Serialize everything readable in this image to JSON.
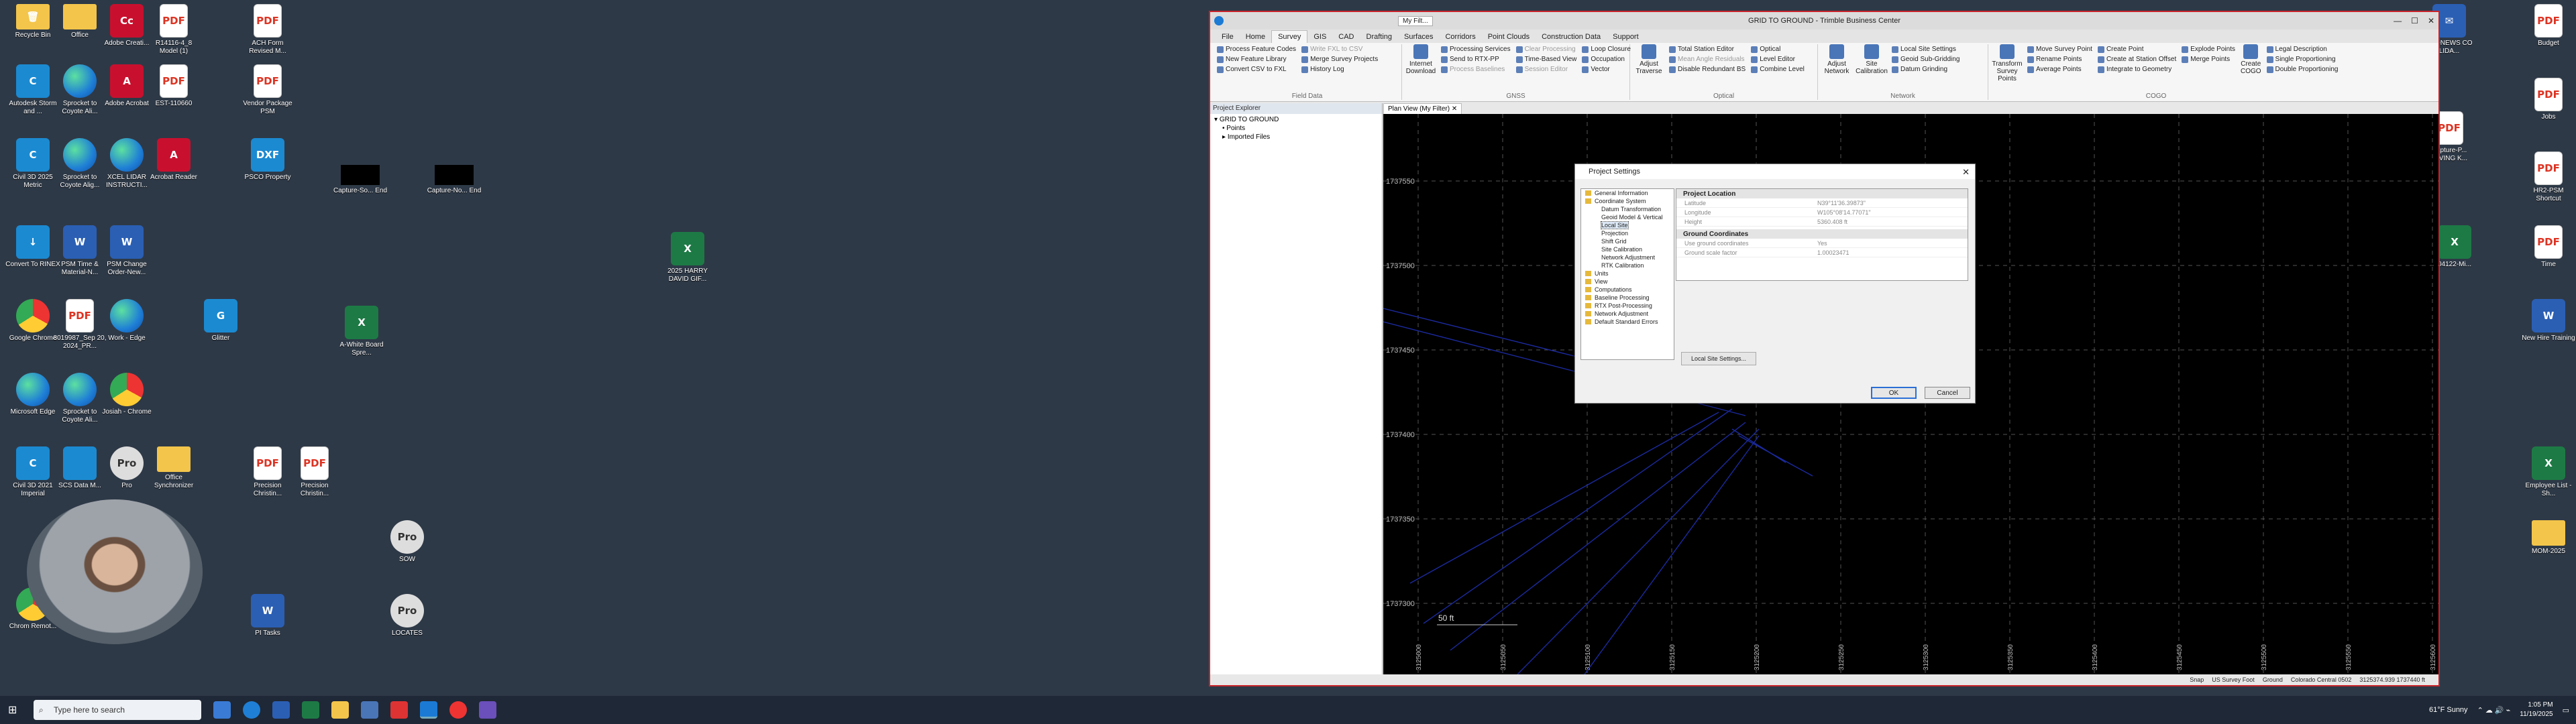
{
  "desktop": {
    "icons": [
      {
        "label": "Recycle Bin",
        "kind": "folder",
        "glyph": "🗑"
      },
      {
        "label": "Office",
        "kind": "folder",
        "glyph": ""
      },
      {
        "label": "Adobe Creati...",
        "kind": "adobe",
        "glyph": "Cc"
      },
      {
        "label": "R14116-4_8 Model (1)",
        "kind": "pdf",
        "glyph": "PDF"
      },
      {
        "label": "ACH Form Revised M...",
        "kind": "pdf",
        "glyph": "PDF"
      },
      {
        "label": "Autodesk Storm and ...",
        "kind": "c3d",
        "glyph": "C"
      },
      {
        "label": "Sprocket to Coyote Ali...",
        "kind": "edge",
        "glyph": ""
      },
      {
        "label": "Adobe Acrobat",
        "kind": "adobe",
        "glyph": "A"
      },
      {
        "label": "EST-110660",
        "kind": "pdf",
        "glyph": "PDF"
      },
      {
        "label": "Vendor Package PSM",
        "kind": "pdf",
        "glyph": "PDF"
      },
      {
        "label": "Civil 3D 2025 Metric",
        "kind": "c3d",
        "glyph": "C"
      },
      {
        "label": "Sprocket to Coyote Alig...",
        "kind": "edge",
        "glyph": ""
      },
      {
        "label": "XCEL LIDAR INSTRUCTI...",
        "kind": "edge",
        "glyph": ""
      },
      {
        "label": "Acrobat Reader",
        "kind": "adobe",
        "glyph": "A"
      },
      {
        "label": "PSCO Property",
        "kind": "c3d",
        "glyph": "DXF"
      },
      {
        "label": "Capture-So... End",
        "kind": "black",
        "glyph": ""
      },
      {
        "label": "Capture-No... End",
        "kind": "black",
        "glyph": ""
      },
      {
        "label": "Convert To RINEX",
        "kind": "c3d",
        "glyph": "↓"
      },
      {
        "label": "PSM Time & Material-N...",
        "kind": "word",
        "glyph": "W"
      },
      {
        "label": "PSM Change Order-New...",
        "kind": "word",
        "glyph": "W"
      },
      {
        "label": "2025 HARRY DAVID GIF...",
        "kind": "excel",
        "glyph": "X"
      },
      {
        "label": "Google Chrome",
        "kind": "chrome",
        "glyph": ""
      },
      {
        "label": "8019987_Sep 20, 2024_PR...",
        "kind": "pdf",
        "glyph": "PDF"
      },
      {
        "label": "Work - Edge",
        "kind": "edge",
        "glyph": ""
      },
      {
        "label": "Glitter",
        "kind": "c3d",
        "glyph": "G"
      },
      {
        "label": "A-White Board Spre...",
        "kind": "excel",
        "glyph": "X"
      },
      {
        "label": "Microsoft Edge",
        "kind": "edge",
        "glyph": ""
      },
      {
        "label": "Sprocket to Coyote Ali...",
        "kind": "edge",
        "glyph": ""
      },
      {
        "label": "Josiah - Chrome",
        "kind": "chrome",
        "glyph": ""
      },
      {
        "label": "Civil 3D 2021 Imperial",
        "kind": "c3d",
        "glyph": "C"
      },
      {
        "label": "SCS Data M...",
        "kind": "c3d",
        "glyph": ""
      },
      {
        "label": "Pro",
        "kind": "pro",
        "glyph": "Pro"
      },
      {
        "label": "Office Synchronizer",
        "kind": "folder",
        "glyph": ""
      },
      {
        "label": "Precision Christin...",
        "kind": "pdf",
        "glyph": "PDF"
      },
      {
        "label": "Precision Christin...",
        "kind": "pdf",
        "glyph": "PDF"
      },
      {
        "label": "SOW",
        "kind": "pro",
        "glyph": "Pro"
      },
      {
        "label": "PI Tasks",
        "kind": "word",
        "glyph": "W"
      },
      {
        "label": "LOCATES",
        "kind": "pro",
        "glyph": "Pro"
      },
      {
        "label": "Chrom Remot...",
        "kind": "chrome",
        "glyph": ""
      },
      {
        "label": "Budget",
        "kind": "pdf",
        "glyph": "PDF"
      },
      {
        "label": "Jobs",
        "kind": "pdf",
        "glyph": "PDF"
      },
      {
        "label": "HR2-PSM Shortcut",
        "kind": "pdf",
        "glyph": "PDF"
      },
      {
        "label": "Time",
        "kind": "pdf",
        "glyph": "PDF"
      },
      {
        "label": "New Hire Training",
        "kind": "word",
        "glyph": "W"
      },
      {
        "label": "Employee List - Sh...",
        "kind": "excel",
        "glyph": "X"
      },
      {
        "label": "MOM-2025",
        "kind": "folder",
        "glyph": ""
      },
      {
        "label": "RT eNEWS CO LIDA...",
        "kind": "word",
        "glyph": "✉"
      },
      {
        "label": "Capture-P... PAVING K...",
        "kind": "pdf",
        "glyph": "PDF"
      },
      {
        "label": "04122-Mi...",
        "kind": "excel",
        "glyph": "X"
      }
    ]
  },
  "app": {
    "title": "GRID TO GROUND - Trimble Business Center",
    "qat_text": "My Filt...",
    "menu_tabs": [
      "File",
      "Home",
      "Survey",
      "GIS",
      "CAD",
      "Drafting",
      "Surfaces",
      "Corridors",
      "Point Clouds",
      "Construction Data",
      "Support"
    ],
    "active_tab": "Survey",
    "ribbon": {
      "field_data": {
        "label": "Field Data",
        "items": [
          "Process Feature Codes",
          "New Feature Library",
          "Convert CSV to FXL",
          "Write FXL to CSV",
          "Merge Survey Projects",
          "History Log"
        ]
      },
      "gnss": {
        "label": "GNSS",
        "big": "Internet Download",
        "items": [
          "Processing Services",
          "Send to RTX-PP",
          "Process Baselines",
          "Clear Processing",
          "Time-Based View",
          "Session Editor",
          "Loop Closure",
          "Occupation",
          "Vector"
        ]
      },
      "optical": {
        "label": "Optical",
        "big": "Adjust Traverse",
        "items": [
          "Total Station Editor",
          "Mean Angle Residuals",
          "Disable Redundant BS",
          "Optical",
          "Level Editor",
          "Combine Level"
        ]
      },
      "network": {
        "label": "Network",
        "big": [
          "Adjust Network",
          "Site Calibration"
        ],
        "items": [
          "Local Site Settings",
          "Geoid Sub-Gridding",
          "Datum Grinding"
        ]
      },
      "cogo": {
        "label": "COGO",
        "big": [
          "Transform Survey Points",
          "Create COGO"
        ],
        "items": [
          "Move Survey Point",
          "Rename Points",
          "Average Points",
          "Create Point",
          "Create at Station Offset",
          "Integrate to Geometry",
          "Explode Points",
          "Merge Points",
          "Legal Description",
          "Single Proportioning",
          "Double Proportioning"
        ]
      }
    },
    "project_explorer": {
      "title": "Project Explorer",
      "root": "GRID TO GROUND",
      "children": [
        "Points",
        "Imported Files"
      ]
    },
    "plan_tab": "Plan View (My Filter)",
    "y_labels": [
      "1737550",
      "1737500",
      "1737450",
      "1737400",
      "1737350",
      "1737300"
    ],
    "x_labels": [
      "3125000",
      "3125050",
      "3125100",
      "3125150",
      "3125200",
      "3125250",
      "3125300",
      "3125350",
      "3125400",
      "3125450",
      "3125500",
      "3125550",
      "3125600"
    ],
    "scale_label": "50 ft",
    "status": {
      "snap": "Snap",
      "units": "US Survey Foot",
      "ground": "Ground",
      "zone": "Colorado Central 0502",
      "coords": "3125374.939 1737440 ft"
    }
  },
  "dialog": {
    "title": "Project Settings",
    "tree": [
      {
        "label": "General Information",
        "lvl": 1
      },
      {
        "label": "Coordinate System",
        "lvl": 1
      },
      {
        "label": "Datum Transformation",
        "lvl": 2
      },
      {
        "label": "Geoid Model & Vertical",
        "lvl": 2
      },
      {
        "label": "Local Site",
        "lvl": 2,
        "sel": true
      },
      {
        "label": "Projection",
        "lvl": 2
      },
      {
        "label": "Shift Grid",
        "lvl": 2
      },
      {
        "label": "Site Calibration",
        "lvl": 2
      },
      {
        "label": "Network Adjustment",
        "lvl": 2
      },
      {
        "label": "RTK Calibration",
        "lvl": 2
      },
      {
        "label": "Units",
        "lvl": 1
      },
      {
        "label": "View",
        "lvl": 1
      },
      {
        "label": "Computations",
        "lvl": 1
      },
      {
        "label": "Baseline Processing",
        "lvl": 1
      },
      {
        "label": "RTX Post-Processing",
        "lvl": 1
      },
      {
        "label": "Network Adjustment",
        "lvl": 1
      },
      {
        "label": "Default Standard Errors",
        "lvl": 1
      }
    ],
    "project_location": {
      "header": "Project Location",
      "rows": [
        {
          "k": "Latitude",
          "v": "N39°11'36.39873\""
        },
        {
          "k": "Longitude",
          "v": "W105°08'14.77071\""
        },
        {
          "k": "Height",
          "v": "5360.408 ft"
        }
      ]
    },
    "ground_coordinates": {
      "header": "Ground Coordinates",
      "rows": [
        {
          "k": "Use ground coordinates",
          "v": "Yes"
        },
        {
          "k": "Ground scale factor",
          "v": "1.00023471"
        }
      ]
    },
    "local_site_button": "Local Site Settings...",
    "ok": "OK",
    "cancel": "Cancel"
  },
  "taskbar": {
    "search_placeholder": "Type here to search",
    "weather": "61°F  Sunny",
    "time": "1:05 PM",
    "date": "11/19/2025"
  },
  "colors": {
    "accent": "#c9242b",
    "desktop": "#2e3947",
    "dialog_focus": "#2a6fd6"
  }
}
